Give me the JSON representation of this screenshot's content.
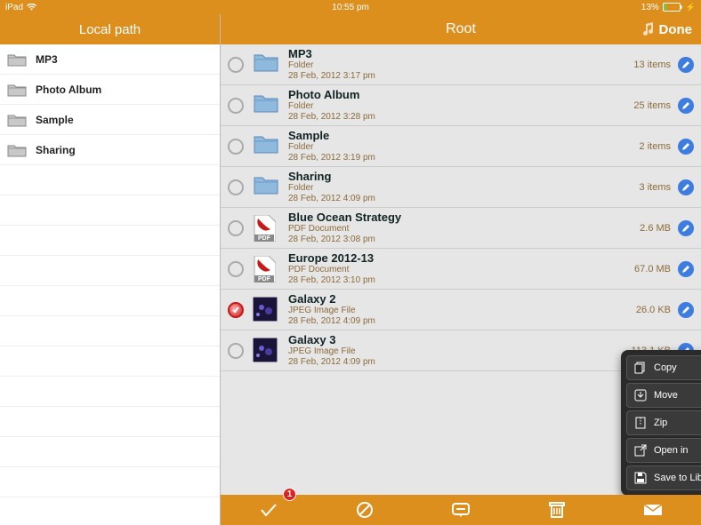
{
  "statusbar": {
    "device": "iPad",
    "time": "10:55 pm",
    "battery": "13%"
  },
  "sidebar": {
    "title": "Local path",
    "items": [
      {
        "label": "MP3"
      },
      {
        "label": "Photo Album"
      },
      {
        "label": "Sample"
      },
      {
        "label": "Sharing"
      }
    ]
  },
  "header": {
    "title": "Root",
    "done": "Done"
  },
  "rows": [
    {
      "name": "MP3",
      "kind": "Folder",
      "date": "28 Feb, 2012 3:17 pm",
      "meta": "13 items",
      "icon": "folder",
      "selected": false
    },
    {
      "name": "Photo Album",
      "kind": "Folder",
      "date": "28 Feb, 2012 3:28 pm",
      "meta": "25 items",
      "icon": "folder",
      "selected": false
    },
    {
      "name": "Sample",
      "kind": "Folder",
      "date": "28 Feb, 2012 3:19 pm",
      "meta": "2 items",
      "icon": "folder",
      "selected": false
    },
    {
      "name": "Sharing",
      "kind": "Folder",
      "date": "28 Feb, 2012 4:09 pm",
      "meta": "3 items",
      "icon": "folder",
      "selected": false
    },
    {
      "name": "Blue Ocean Strategy",
      "kind": "PDF Document",
      "date": "28 Feb, 2012 3:08 pm",
      "meta": "2.6 MB",
      "icon": "pdf",
      "selected": false
    },
    {
      "name": "Europe 2012-13",
      "kind": "PDF Document",
      "date": "28 Feb, 2012 3:10 pm",
      "meta": "67.0 MB",
      "icon": "pdf",
      "selected": false
    },
    {
      "name": "Galaxy 2",
      "kind": "JPEG Image File",
      "date": "28 Feb, 2012 4:09 pm",
      "meta": "26.0 KB",
      "icon": "image",
      "selected": true
    },
    {
      "name": "Galaxy 3",
      "kind": "JPEG Image File",
      "date": "28 Feb, 2012 4:09 pm",
      "meta": "113.1 KB",
      "icon": "image",
      "selected": false
    }
  ],
  "popover": {
    "items": [
      {
        "label": "Copy",
        "icon": "copy"
      },
      {
        "label": "Move",
        "icon": "move"
      },
      {
        "label": "Zip",
        "icon": "zip"
      },
      {
        "label": "Open in",
        "icon": "openin"
      },
      {
        "label": "Save to Library",
        "icon": "save"
      }
    ]
  },
  "toolbar_badge": "1"
}
